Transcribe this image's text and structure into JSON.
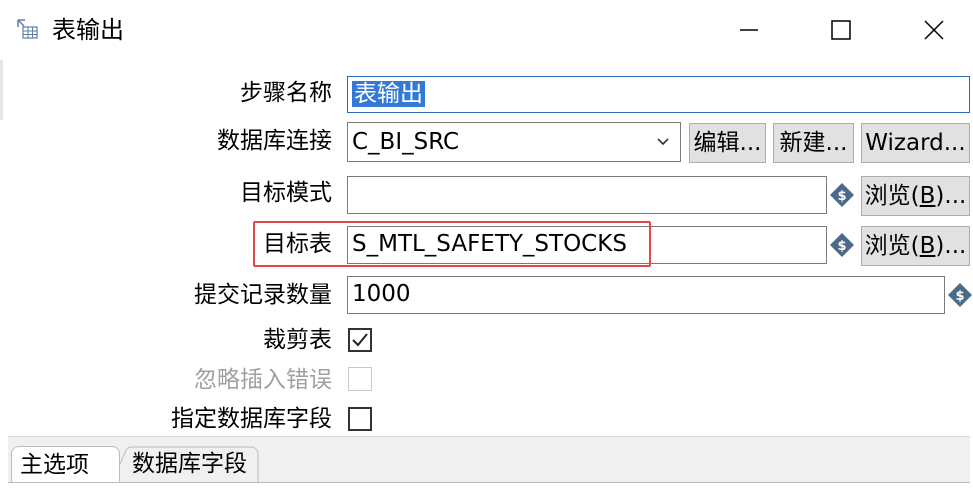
{
  "window": {
    "title": "表输出",
    "icon": "table-output-icon",
    "controls": [
      "minimize-icon",
      "maximize-icon",
      "close-icon"
    ]
  },
  "form": {
    "step_name": {
      "label": "步骤名称",
      "value": "表输出"
    },
    "connection": {
      "label": "数据库连接",
      "value": "C_BI_SRC",
      "edit_button": "编辑...",
      "new_button": "新建...",
      "wizard_button": "Wizard..."
    },
    "target_schema": {
      "label": "目标模式",
      "value": "",
      "browse_button": "浏览(",
      "browse_key": "B",
      "browse_suffix": ")..."
    },
    "target_table": {
      "label": "目标表",
      "value": "S_MTL_SAFETY_STOCKS",
      "browse_button": "浏览(",
      "browse_key": "B",
      "browse_suffix": ")..."
    },
    "commit_size": {
      "label": "提交记录数量",
      "value": "1000"
    },
    "truncate_table": {
      "label": "裁剪表",
      "checked": true
    },
    "ignore_insert_errors": {
      "label": "忽略插入错误",
      "checked": false,
      "disabled": true
    },
    "specify_db_fields": {
      "label": "指定数据库字段",
      "checked": false
    }
  },
  "tabs": [
    {
      "label": "主选项",
      "active": true
    },
    {
      "label": "数据库字段",
      "active": false
    }
  ],
  "colors": {
    "selection": "#3579d6",
    "highlight_border": "#e0484a",
    "variable_icon": "#4b6a8a"
  }
}
